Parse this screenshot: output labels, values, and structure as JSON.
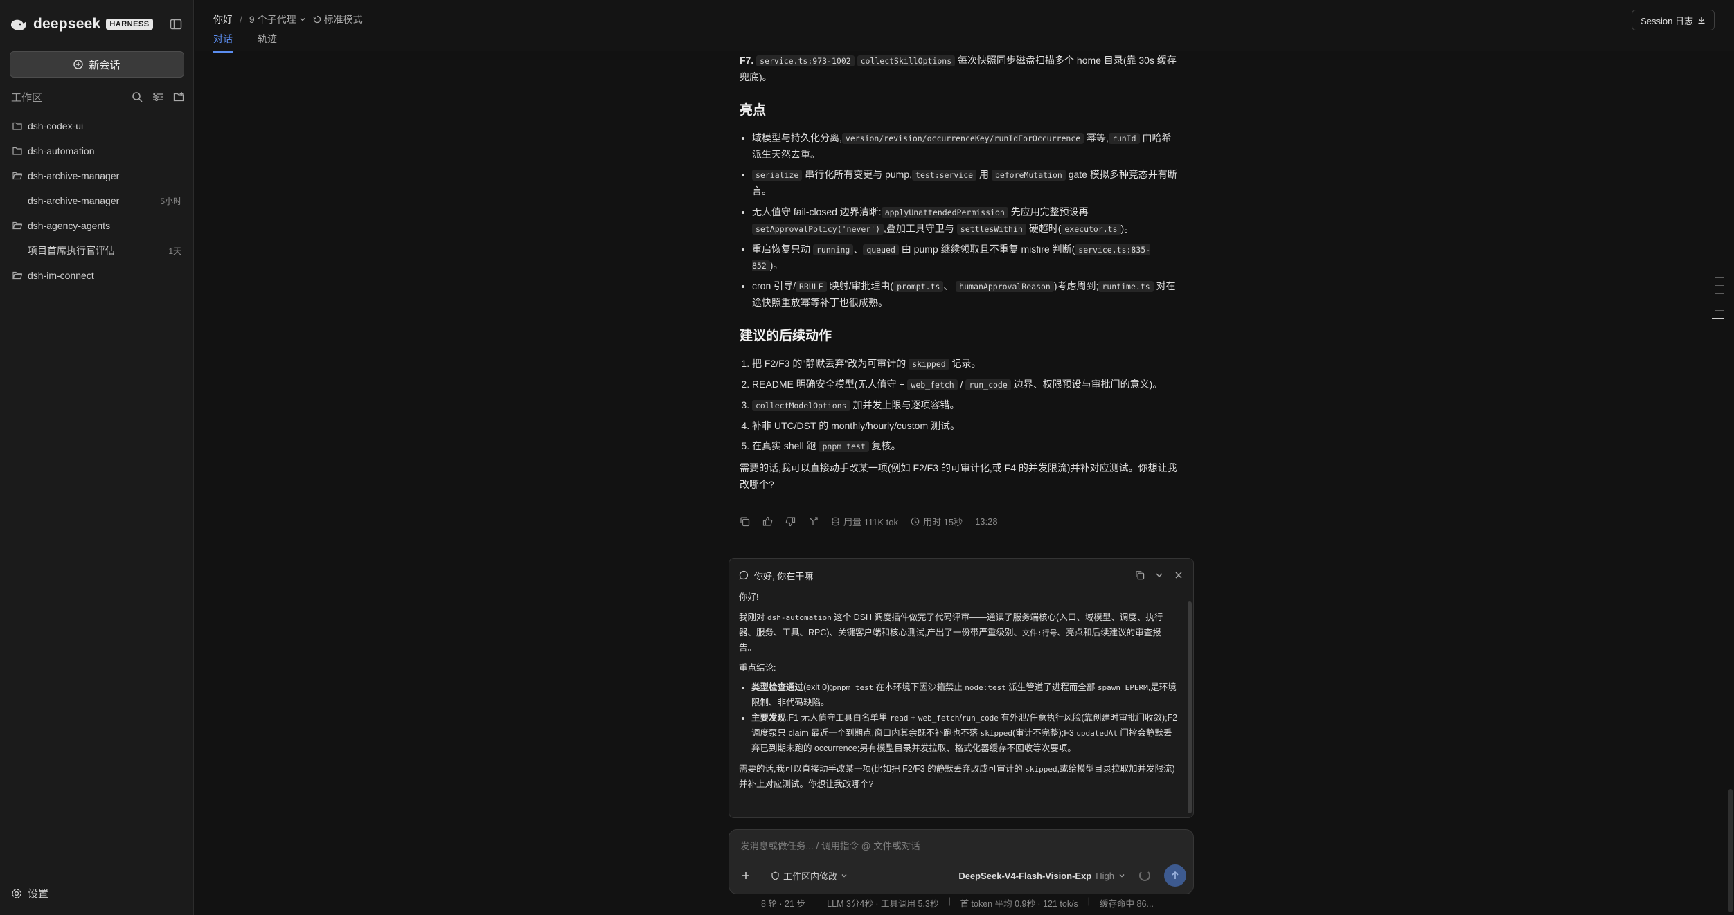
{
  "sidebar": {
    "brand": "deepseek",
    "badge": "HARNESS",
    "new_chat": "新会话",
    "workspace_label": "工作区",
    "items": [
      {
        "label": "dsh-codex-ui",
        "time": ""
      },
      {
        "label": "dsh-automation",
        "time": ""
      },
      {
        "label": "dsh-archive-manager",
        "time": ""
      },
      {
        "label": "dsh-archive-manager",
        "time": "5小时"
      },
      {
        "label": "dsh-agency-agents",
        "time": ""
      },
      {
        "label": "项目首席执行官评估",
        "time": "1天"
      },
      {
        "label": "dsh-im-connect",
        "time": ""
      }
    ],
    "settings": "设置"
  },
  "topbar": {
    "title": "你好",
    "sep": "/",
    "subagents": "9 个子代理",
    "mode": "标准模式",
    "tabs": [
      "对话",
      "轨迹"
    ],
    "session_btn": "Session 日志"
  },
  "content": {
    "f7": {
      "label": "F7.",
      "code1": "service.ts:973-1002",
      "code2": "collectSkillOptions",
      "text": "每次快照同步磁盘扫描多个 home 目录(靠 30s 缓存兜底)。"
    },
    "highlights_title": "亮点",
    "highlights": [
      {
        "a": "域模型与持久化分离,",
        "c1": "version/revision/occurrenceKey/runIdForOccurrence",
        "b": "幂等,",
        "c2": "runId",
        "d": "由哈希派生天然去重。"
      },
      {
        "c1": "serialize",
        "a": "串行化所有变更与 pump,",
        "c2": "test:service",
        "b": "用",
        "c3": "beforeMutation",
        "d": "gate 模拟多种竞态并有断言。"
      },
      {
        "a": "无人值守 fail-closed 边界清晰:",
        "c1": "applyUnattendedPermission",
        "b": "先应用完整预设再",
        "c2": "setApprovalPolicy('never')",
        "d": ",叠加工具守卫与",
        "c3": "settlesWithin",
        "e": "硬超时(",
        "c4": "executor.ts",
        "f": ")。"
      },
      {
        "a": "重启恢复只动",
        "c1": "running",
        "b": "、",
        "c2": "queued",
        "d": "由 pump 继续领取且不重复 misfire 判断(",
        "c3": "service.ts:835-852",
        "e": ")。"
      },
      {
        "a": "cron 引导/",
        "c1": "RRULE",
        "b": "映射/审批理由(",
        "c2": "prompt.ts",
        "d": "、",
        "c3": "humanApprovalReason",
        "e": ")考虑周到;",
        "c4": "runtime.ts",
        "f": "对在途快照重放幂等补丁也很成熟。"
      }
    ],
    "next_title": "建议的后续动作",
    "next": [
      {
        "a": "把 F2/F3 的\"静默丢弃\"改为可审计的",
        "c1": "skipped",
        "b": "记录。"
      },
      {
        "a": "README 明确安全模型(无人值守 +",
        "c1": "web_fetch",
        "b": "/",
        "c2": "run_code",
        "d": "边界、权限预设与审批门的意义)。"
      },
      {
        "c1": "collectModelOptions",
        "a": "加并发上限与逐项容错。"
      },
      {
        "a": "补非 UTC/DST 的 monthly/hourly/custom 测试。"
      },
      {
        "a": "在真实 shell 跑",
        "c1": "pnpm test",
        "b": "复核。"
      }
    ],
    "closing": "需要的话,我可以直接动手改某一项(例如 F2/F3 的可审计化,或 F4 的并发限流)并补对应测试。你想让我改哪个?"
  },
  "actions": {
    "usage": "用量 111K tok",
    "duration": "用时 15秒",
    "time": "13:28"
  },
  "subpanel": {
    "title": "你好, 你在干嘛",
    "greeting": "你好!",
    "p1": {
      "a": "我刚对",
      "c1": "dsh-automation",
      "b": "这个 DSH 调度插件做完了代码评审——通读了服务端核心(入口、域模型、调度、执行器、服务、工具、RPC)、关键客户端和核心测试,产出了一份带严重级别、",
      "c2": "文件:行号",
      "d": "、亮点和后续建议的审查报告。"
    },
    "conclusion_label": "重点结论:",
    "bullets": [
      {
        "bold": "类型检查通过",
        "a": "(exit 0);",
        "c1": "pnpm test",
        "b": "在本环境下因沙箱禁止",
        "c2": "node:test",
        "d": "派生管道子进程而全部",
        "c3": "spawn EPERM",
        "e": ",是环境限制、非代码缺陷。"
      },
      {
        "bold": "主要发现",
        "a": ":F1 无人值守工具白名单里",
        "c1": "read",
        "b": "+",
        "c2": "web_fetch",
        "d": "/",
        "c3": "run_code",
        "e": "有外泄/任意执行风险(靠创建时审批门收敛);F2 调度泵只 claim 最近一个到期点,窗口内其余既不补跑也不落",
        "c4": "skipped",
        "f": "(审计不完整);F3",
        "c5": "updatedAt",
        "g": "门控会静默丢弃已到期未跑的 occurrence;另有模型目录并发拉取、格式化器缓存不回收等次要项。"
      }
    ],
    "closing": {
      "a": "需要的话,我可以直接动手改某一项(比如把 F2/F3 的静默丢弃改成可审计的",
      "c1": "skipped",
      "b": ",或给模型目录拉取加并发限流)并补上对应测试。你想让我改哪个?"
    }
  },
  "composer": {
    "placeholder": "发消息或做任务... / 调用指令 @ 文件或对话",
    "mode": "工作区内修改",
    "model": "DeepSeek-V4-Flash-Vision-Exp",
    "effort": "High"
  },
  "stats": [
    "8 轮 · 21 步",
    "|",
    "LLM 3分4秒 · 工具调用 5.3秒",
    "|",
    "首 token 平均 0.9秒 · 121 tok/s",
    "|",
    "缓存命中 86..."
  ],
  "colors": {
    "accent": "#5b8def",
    "bg": "#121212",
    "sidebar": "#1b1b1b"
  }
}
